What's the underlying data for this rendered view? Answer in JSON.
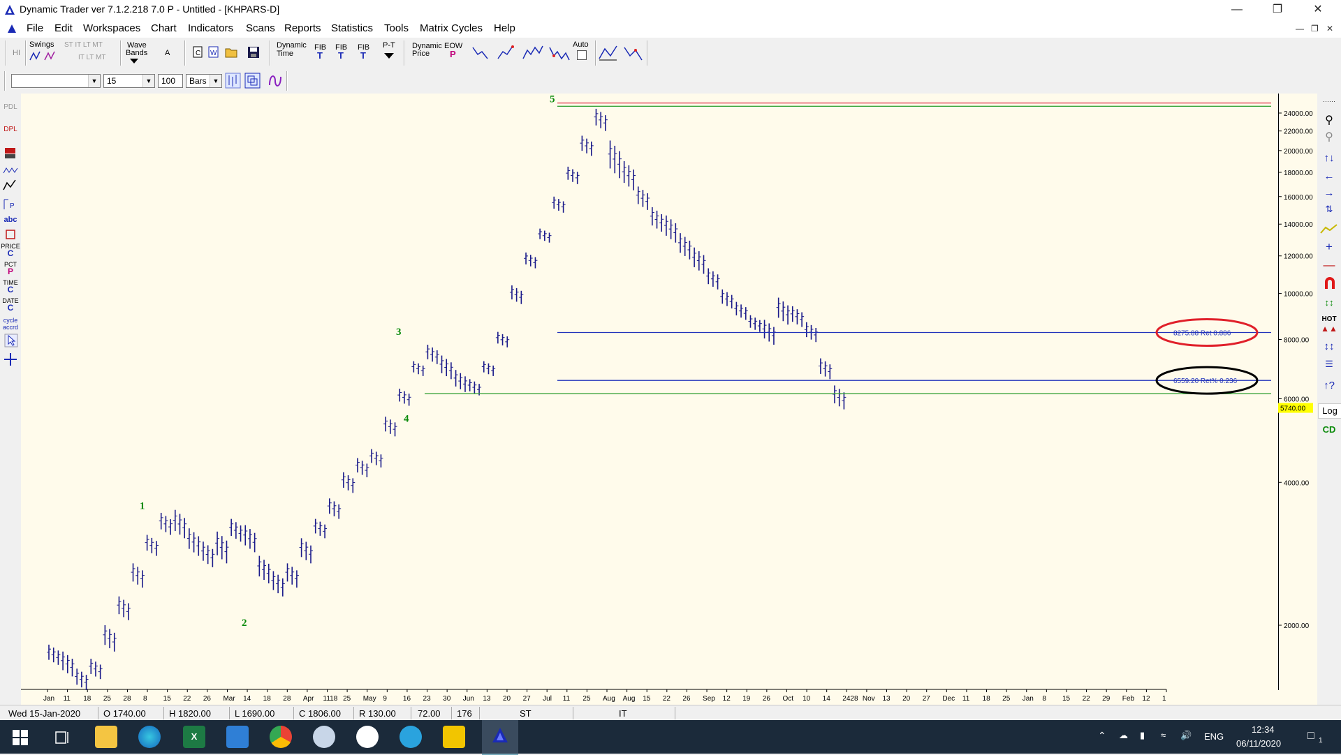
{
  "window": {
    "title": "Dynamic Trader ver 7.1.2.218 7.0 P - Untitled - [KHPARS-D]"
  },
  "menu": [
    "File",
    "Edit",
    "Workspaces",
    "Chart",
    "Indicators",
    "Scans",
    "Reports",
    "Statistics",
    "Tools",
    "Matrix Cycles",
    "Help"
  ],
  "toolbar": {
    "hi": "HI",
    "swings": "Swings",
    "st_it": "ST IT LT MT",
    "it_lt": "IT LT MT",
    "wave_bands_1": "Wave",
    "wave_bands_2": "Bands",
    "a": "A",
    "dynamic_time_1": "Dynamic",
    "dynamic_time_2": "Time",
    "fib": "FIB",
    "fib_t": "T",
    "pt": "P-T",
    "dynamic_price_1": "Dynamic",
    "dynamic_price_2": "Price",
    "eow": "EOW",
    "eow_p": "P",
    "auto": "Auto"
  },
  "toolbar2": {
    "symbol": "",
    "period": "15",
    "bars_count": "100",
    "bars_unit": "Bars"
  },
  "left_panel": [
    "PDL",
    "DPL",
    "P",
    "abc",
    "PRICE",
    "C",
    "PCT",
    "P",
    "TIME",
    "C",
    "DATE",
    "C",
    "cycle",
    "accrd"
  ],
  "chart": {
    "log_scale": true,
    "y_ticks": [
      "24000.00",
      "22000.00",
      "20000.00",
      "18000.00",
      "16000.00",
      "14000.00",
      "12000.00",
      "10000.00",
      "8000.00",
      "6000.00",
      "4000.00",
      "2000.00"
    ],
    "y_tick_values": [
      24000,
      22000,
      20000,
      18000,
      16000,
      14000,
      12000,
      10000,
      8000,
      6000,
      4000,
      2000
    ],
    "last_price": "5740.00",
    "x_ticks": [
      "Jan",
      "11",
      "18",
      "25",
      "28",
      "8",
      "15",
      "22",
      "26",
      "Mar",
      "14",
      "18",
      "28",
      "Apr",
      "1118",
      "25",
      "May",
      "9",
      "16",
      "23",
      "30",
      "Jun",
      "13",
      "20",
      "27",
      "Jul",
      "11",
      "25",
      "Aug",
      "Aug",
      "15",
      "22",
      "26",
      "Sep",
      "12",
      "19",
      "26",
      "Oct",
      "10",
      "14",
      "2428",
      "Nov",
      "13",
      "20",
      "27",
      "Dec",
      "11",
      "18",
      "25",
      "Jan",
      "8",
      "15",
      "22",
      "29",
      "Feb",
      "12",
      "1"
    ],
    "wave_labels": [
      {
        "label": "1",
        "date": "2020-02-10",
        "price": 3400
      },
      {
        "label": "2",
        "date": "2020-03-12",
        "price": 2250
      },
      {
        "label": "3",
        "date": "2020-05-15",
        "price": 7900
      },
      {
        "label": "4",
        "date": "2020-05-30",
        "price": 6100
      },
      {
        "label": "5",
        "date": "2020-07-25",
        "price": 24800
      }
    ],
    "horizontal_lines": [
      {
        "price": 25200,
        "color": "#e0304a"
      },
      {
        "price": 24800,
        "color": "#3aa33a"
      },
      {
        "price": 8275.88,
        "color": "#2233bb",
        "label": "8275.88 Ret 0.886"
      },
      {
        "price": 6559.2,
        "color": "#2233bb",
        "label": "6559.20 Ret% 0.236"
      },
      {
        "price": 6150,
        "color": "#3aa33a"
      }
    ],
    "annotations": [
      {
        "text": "8275.88 Ret 0.886",
        "circle_color": "#e0202a"
      },
      {
        "text": "6559.20 Ret% 0.236",
        "circle_color": "#000000"
      }
    ],
    "price_series": {
      "description_dates": "weekly bars 2020-01-06 to 2020-10-28",
      "highs": [
        1820,
        1760,
        1620,
        1700,
        2000,
        2300,
        2700,
        3100,
        3450,
        3500,
        3200,
        3000,
        3150,
        3350,
        3250,
        2800,
        2600,
        2700,
        3050,
        3350,
        3700,
        4200,
        4500,
        4700,
        5500,
        6300,
        7200,
        7800,
        7400,
        6900,
        6600,
        7200,
        8300,
        10400,
        12200,
        13700,
        16000,
        18500,
        21500,
        24500,
        21000,
        19000,
        16800,
        15200,
        14600,
        13400,
        12500,
        11300,
        10200,
        9600,
        9000,
        8800,
        9800,
        9400,
        8700,
        7300,
        6400
      ],
      "lows": [
        1650,
        1560,
        1460,
        1540,
        1760,
        2050,
        2400,
        2800,
        3100,
        3050,
        2800,
        2650,
        2700,
        3000,
        2850,
        2450,
        2300,
        2400,
        2700,
        3050,
        3350,
        3800,
        4100,
        4300,
        5000,
        5800,
        6700,
        7100,
        6600,
        6200,
        6100,
        6700,
        7700,
        9500,
        11300,
        12800,
        14800,
        17000,
        19500,
        22000,
        17500,
        16500,
        15000,
        13500,
        12800,
        11800,
        11000,
        10200,
        9300,
        8800,
        8300,
        7800,
        8600,
        8500,
        7900,
        6600,
        5700
      ]
    }
  },
  "status": {
    "date": "Wed 15-Jan-2020",
    "open": "O 1740.00",
    "high": "H 1820.00",
    "low": "L 1690.00",
    "close": "C 1806.00",
    "range": "R 130.00",
    "v1": "72.00",
    "v2": "176",
    "st": "ST",
    "it": "IT"
  },
  "right_tools": [
    "HOT",
    "Log",
    "CD"
  ],
  "taskbar": {
    "lang": "ENG",
    "time": "12:34",
    "date": "06/11/2020",
    "notif": "1"
  }
}
